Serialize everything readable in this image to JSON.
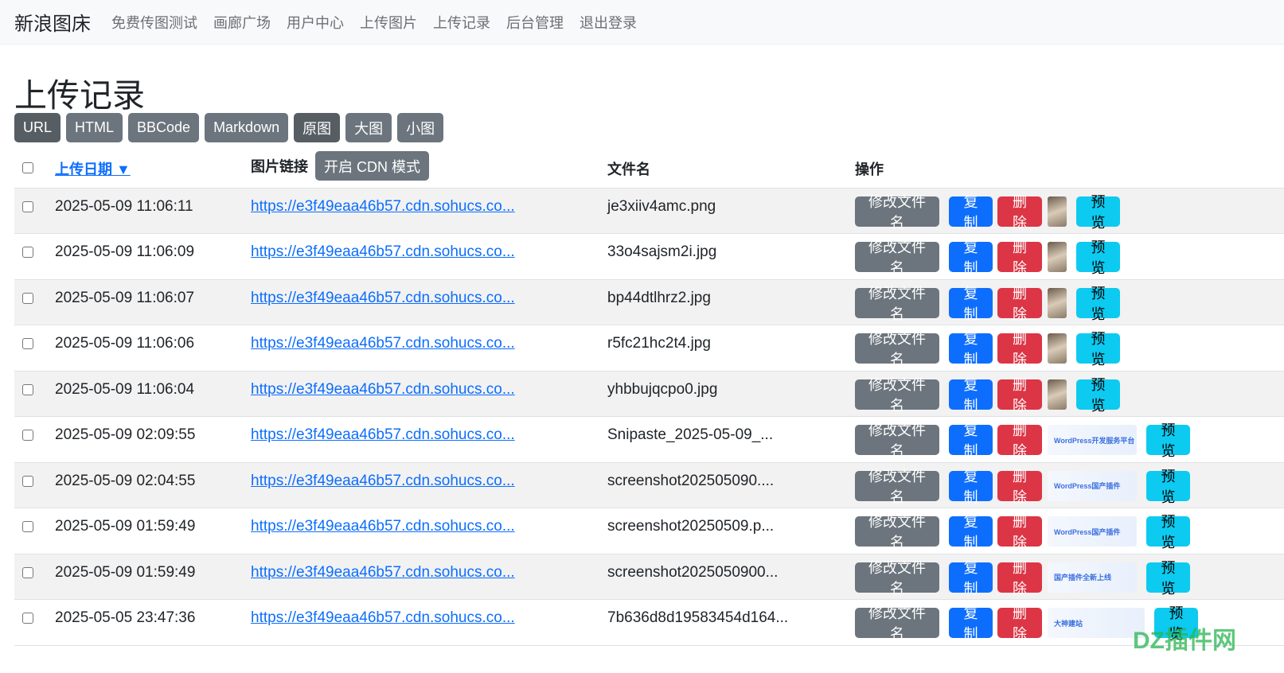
{
  "nav": {
    "brand": "新浪图床",
    "items": [
      "免费传图测试",
      "画廊广场",
      "用户中心",
      "上传图片",
      "上传记录",
      "后台管理",
      "退出登录"
    ]
  },
  "page_title": "上传记录",
  "formats": [
    "URL",
    "HTML",
    "BBCode",
    "Markdown",
    "原图",
    "大图",
    "小图"
  ],
  "table": {
    "headers": {
      "date": "上传日期 ▼",
      "link": "图片链接",
      "cdn_button": "开启 CDN 模式",
      "filename": "文件名",
      "actions": "操作"
    },
    "action_labels": {
      "rename": "修改文件名",
      "copy": "复制",
      "delete": "删除",
      "preview": "预览"
    },
    "rows": [
      {
        "date": "2025-05-09 11:06:11",
        "link": "https://e3f49eaa46b57.cdn.sohucs.co...",
        "filename": "je3xiiv4amc.png",
        "thumb": "photo"
      },
      {
        "date": "2025-05-09 11:06:09",
        "link": "https://e3f49eaa46b57.cdn.sohucs.co...",
        "filename": "33o4sajsm2i.jpg",
        "thumb": "photo"
      },
      {
        "date": "2025-05-09 11:06:07",
        "link": "https://e3f49eaa46b57.cdn.sohucs.co...",
        "filename": "bp44dtlhrz2.jpg",
        "thumb": "photo"
      },
      {
        "date": "2025-05-09 11:06:06",
        "link": "https://e3f49eaa46b57.cdn.sohucs.co...",
        "filename": "r5fc21hc2t4.jpg",
        "thumb": "photo"
      },
      {
        "date": "2025-05-09 11:06:04",
        "link": "https://e3f49eaa46b57.cdn.sohucs.co...",
        "filename": "yhbbujqcpo0.jpg",
        "thumb": "photo"
      },
      {
        "date": "2025-05-09 02:09:55",
        "link": "https://e3f49eaa46b57.cdn.sohucs.co...",
        "filename": "Snipaste_2025-05-09_...",
        "thumb": "WordPress开发服务平台"
      },
      {
        "date": "2025-05-09 02:04:55",
        "link": "https://e3f49eaa46b57.cdn.sohucs.co...",
        "filename": "screenshot202505090....",
        "thumb": "WordPress国产插件"
      },
      {
        "date": "2025-05-09 01:59:49",
        "link": "https://e3f49eaa46b57.cdn.sohucs.co...",
        "filename": "screenshot20250509.p...",
        "thumb": "WordPress国产插件"
      },
      {
        "date": "2025-05-09 01:59:49",
        "link": "https://e3f49eaa46b57.cdn.sohucs.co...",
        "filename": "screenshot2025050900...",
        "thumb": "国产插件全新上线"
      },
      {
        "date": "2025-05-05 23:47:36",
        "link": "https://e3f49eaa46b57.cdn.sohucs.co...",
        "filename": "7b636d8d19583454d164...",
        "thumb": "大神建站"
      }
    ]
  },
  "watermark": "DZ插件网"
}
